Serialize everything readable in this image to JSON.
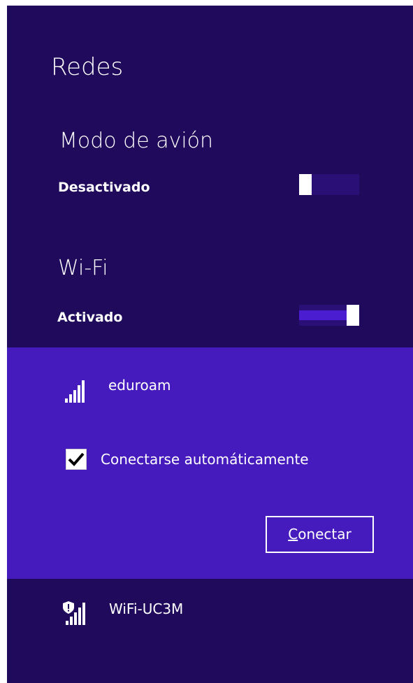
{
  "panel": {
    "title": "Redes"
  },
  "airplane": {
    "heading": "Modo de avión",
    "state": "Desactivado",
    "on": false
  },
  "wifi": {
    "heading": "Wi-Fi",
    "state": "Activado",
    "on": true
  },
  "networks": [
    {
      "name": "eduroam",
      "icon": "wifi-signal-icon",
      "expanded": true,
      "auto_connect_label": "Conectarse automáticamente",
      "auto_connect_checked": true,
      "connect_button": {
        "access_key": "C",
        "rest": "onectar"
      }
    },
    {
      "name": "WiFi-UC3M",
      "icon": "secured-wifi-signal-icon",
      "expanded": false
    }
  ],
  "colors": {
    "background": "#1f0a5b",
    "selected_network": "#451bbd",
    "toggle_track": "#2a0f76",
    "toggle_fill": "#4a1ed0"
  }
}
